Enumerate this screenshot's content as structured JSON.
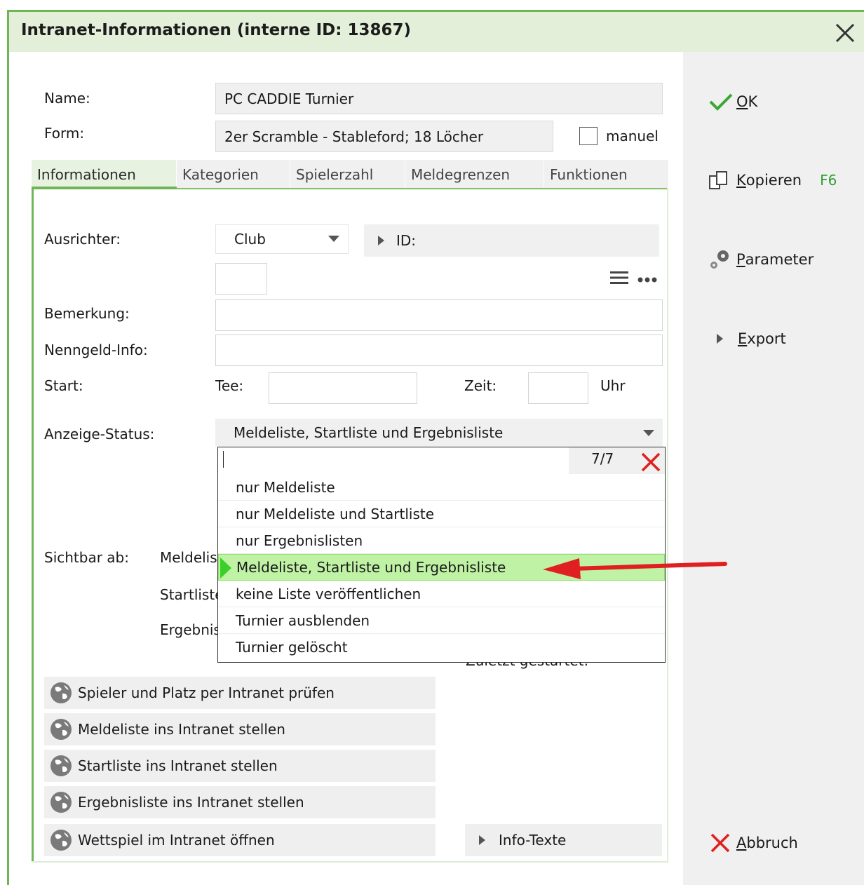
{
  "window": {
    "title": "Intranet-Informationen (interne ID: 13867)"
  },
  "form": {
    "name_label": "Name:",
    "name_value": "PC CADDIE Turnier",
    "form_label": "Form:",
    "form_value": "2er Scramble - Stableford; 18 Löcher",
    "manual_label": "manuel",
    "manual_checked": false
  },
  "tabs": [
    {
      "label": "Informationen",
      "active": true
    },
    {
      "label": "Kategorien"
    },
    {
      "label": "Spielerzahl"
    },
    {
      "label": "Meldegrenzen"
    },
    {
      "label": "Funktionen"
    }
  ],
  "info": {
    "ausrichter_label": "Ausrichter:",
    "ausrichter_value": "Club",
    "id_label": "ID:",
    "bemerkung_label": "Bemerkung:",
    "nenngeld_label": "Nenngeld-Info:",
    "start_label": "Start:",
    "tee_label": "Tee:",
    "zeit_label": "Zeit:",
    "uhr_label": "Uhr",
    "anzeige_label": "Anzeige-Status:",
    "anzeige_value": "Meldeliste, Startliste und Ergebnisliste",
    "sichtbar_label": "Sichtbar ab:",
    "melde_partial": "Meldelis",
    "start_partial": "Startliste",
    "ergebnis_partial": "Ergebnis",
    "hidden_partial": "Zuletzt gestartet:"
  },
  "dropdown": {
    "search_value": "",
    "count": "7/7",
    "options": [
      "nur Meldeliste",
      "nur Meldeliste und Startliste",
      "nur Ergebnislisten",
      "Meldeliste, Startliste und Ergebnisliste",
      "keine Liste veröffentlichen",
      "Turnier ausblenden",
      "Turnier gelöscht"
    ],
    "selected_index": 3
  },
  "actions": [
    "Spieler und Platz per Intranet prüfen",
    "Meldeliste ins Intranet stellen",
    "Startliste ins Intranet stellen",
    "Ergebnisliste ins Intranet stellen",
    "Wettspiel im Intranet öffnen"
  ],
  "info_texte_label": "Info-Texte",
  "sidebar": {
    "ok": {
      "first": "O",
      "rest": "K"
    },
    "kopieren": {
      "first": "K",
      "rest": "opieren",
      "shortcut": "F6"
    },
    "parameter": {
      "first": "P",
      "rest": "arameter"
    },
    "export": {
      "first": "E",
      "rest": "xport"
    },
    "abbruch": {
      "first": "A",
      "rest": "bbruch"
    }
  },
  "colors": {
    "accent_green": "#6fb556",
    "title_bg": "#e3efd9",
    "selected_bg": "#bff2a4",
    "red": "#e02020",
    "shortcut_green": "#2e9e2e"
  }
}
